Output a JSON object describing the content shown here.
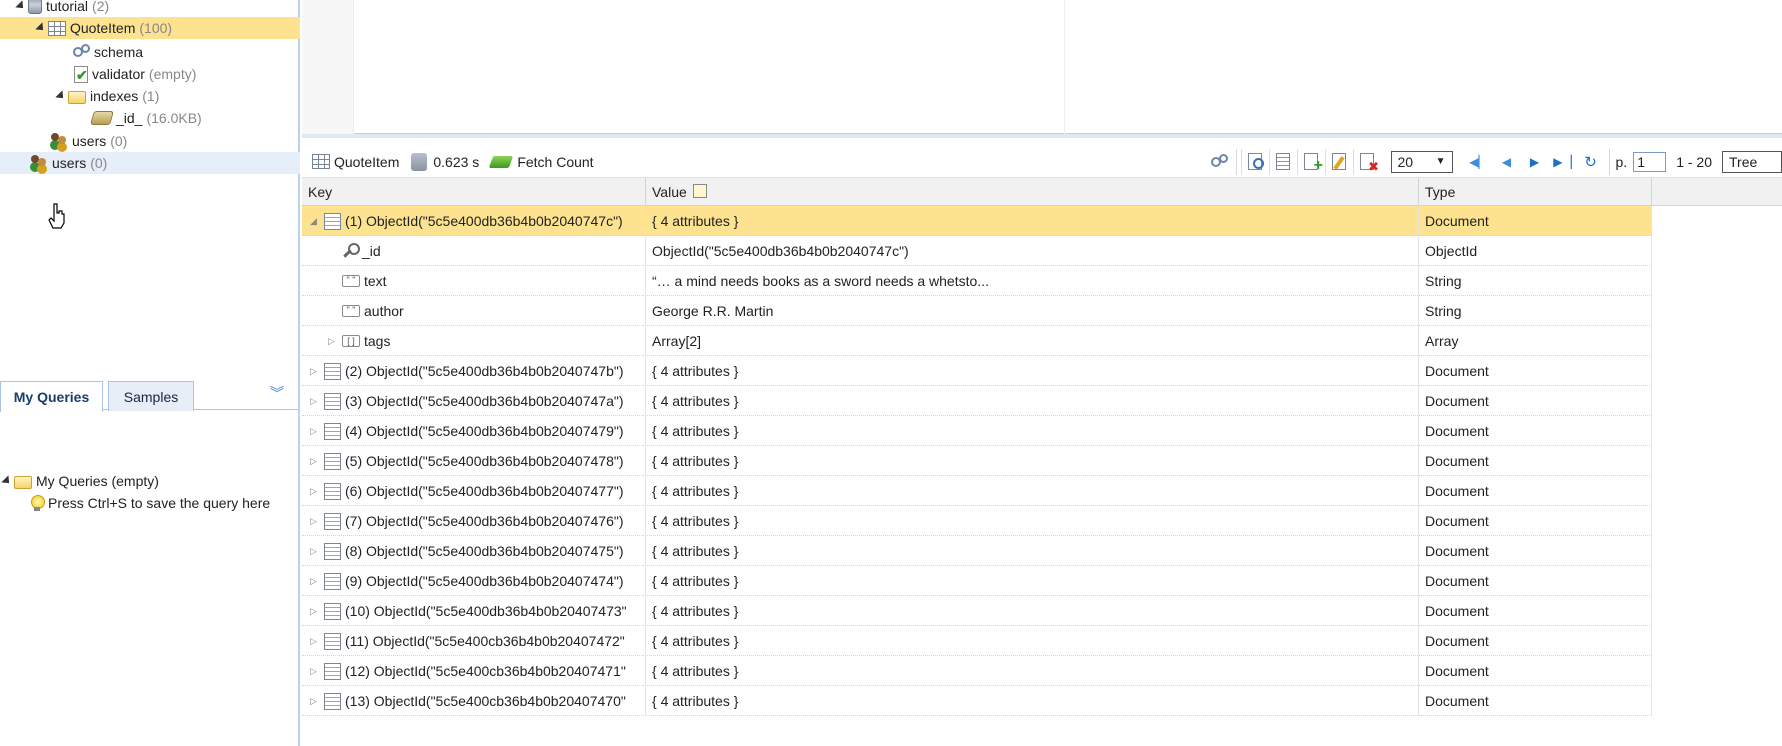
{
  "tree": {
    "db": {
      "name": "tutorial",
      "count": "(2)"
    },
    "collection": {
      "name": "QuoteItem",
      "count": "(100)"
    },
    "schema": "schema",
    "validator": {
      "name": "validator",
      "note": "(empty)"
    },
    "indexes": {
      "name": "indexes",
      "count": "(1)"
    },
    "index_id": {
      "name": "_id_",
      "size": "(16.0KB)"
    },
    "users_inner": {
      "name": "users",
      "count": "(0)"
    },
    "users_outer": {
      "name": "users",
      "count": "(0)"
    }
  },
  "queries": {
    "tabs": [
      "My Queries",
      "Samples"
    ],
    "root": "My Queries (empty)",
    "hint": "Press Ctrl+S to save the query here"
  },
  "toolbar": {
    "collection": "QuoteItem",
    "time": "0.623 s",
    "fetch_count": "Fetch Count",
    "page_size": "20",
    "page_label": "p.",
    "page": "1",
    "range": "1 - 20",
    "view": "Tree"
  },
  "grid": {
    "headers": {
      "key": "Key",
      "value": "Value",
      "type": "Type"
    },
    "rows": [
      {
        "key": "(1) ObjectId(\"5c5e400db36b4b0b2040747c\")",
        "value": "{ 4 attributes }",
        "type": "Document"
      },
      {
        "key": "_id",
        "value": "ObjectId(\"5c5e400db36b4b0b2040747c\")",
        "type": "ObjectId"
      },
      {
        "key": "text",
        "value": "“… a mind needs books as a sword needs a whetsto...",
        "type": "String"
      },
      {
        "key": "author",
        "value": "George R.R. Martin",
        "type": "String"
      },
      {
        "key": "tags",
        "value": "Array[2]",
        "type": "Array"
      },
      {
        "key": "(2) ObjectId(\"5c5e400db36b4b0b2040747b\")",
        "value": "{ 4 attributes }",
        "type": "Document"
      },
      {
        "key": "(3) ObjectId(\"5c5e400db36b4b0b2040747a\")",
        "value": "{ 4 attributes }",
        "type": "Document"
      },
      {
        "key": "(4) ObjectId(\"5c5e400db36b4b0b20407479\")",
        "value": "{ 4 attributes }",
        "type": "Document"
      },
      {
        "key": "(5) ObjectId(\"5c5e400db36b4b0b20407478\")",
        "value": "{ 4 attributes }",
        "type": "Document"
      },
      {
        "key": "(6) ObjectId(\"5c5e400db36b4b0b20407477\")",
        "value": "{ 4 attributes }",
        "type": "Document"
      },
      {
        "key": "(7) ObjectId(\"5c5e400db36b4b0b20407476\")",
        "value": "{ 4 attributes }",
        "type": "Document"
      },
      {
        "key": "(8) ObjectId(\"5c5e400db36b4b0b20407475\")",
        "value": "{ 4 attributes }",
        "type": "Document"
      },
      {
        "key": "(9) ObjectId(\"5c5e400db36b4b0b20407474\")",
        "value": "{ 4 attributes }",
        "type": "Document"
      },
      {
        "key": "(10) ObjectId(\"5c5e400db36b4b0b20407473\"",
        "value": "{ 4 attributes }",
        "type": "Document"
      },
      {
        "key": "(11) ObjectId(\"5c5e400cb36b4b0b20407472\"",
        "value": "{ 4 attributes }",
        "type": "Document"
      },
      {
        "key": "(12) ObjectId(\"5c5e400cb36b4b0b20407471\"",
        "value": "{ 4 attributes }",
        "type": "Document"
      },
      {
        "key": "(13) ObjectId(\"5c5e400cb36b4b0b20407470\"",
        "value": "{ 4 attributes }",
        "type": "Document"
      }
    ]
  }
}
